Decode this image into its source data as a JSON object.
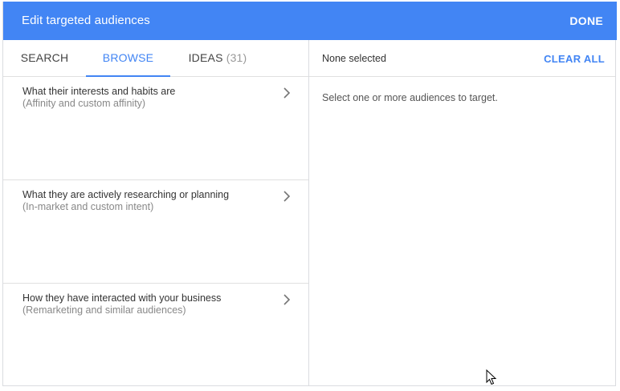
{
  "dialog": {
    "title": "Edit targeted audiences",
    "done_label": "DONE",
    "accent_color": "#4285f4"
  },
  "tabs": [
    {
      "label": "SEARCH",
      "active": false
    },
    {
      "label": "BROWSE",
      "active": true
    },
    {
      "label": "IDEAS",
      "count": "(31)",
      "active": false
    }
  ],
  "categories": [
    {
      "title": "What their interests and habits are",
      "subtitle": "(Affinity and custom affinity)",
      "icon": "chevron-right-icon"
    },
    {
      "title": "What they are actively researching or planning",
      "subtitle": "(In-market and custom intent)",
      "icon": "chevron-right-icon"
    },
    {
      "title": "How they have interacted with your business",
      "subtitle": "(Remarketing and similar audiences)",
      "icon": "chevron-right-icon"
    }
  ],
  "selection": {
    "status": "None selected",
    "clear_label": "CLEAR ALL",
    "empty_message": "Select one or more audiences to target."
  }
}
